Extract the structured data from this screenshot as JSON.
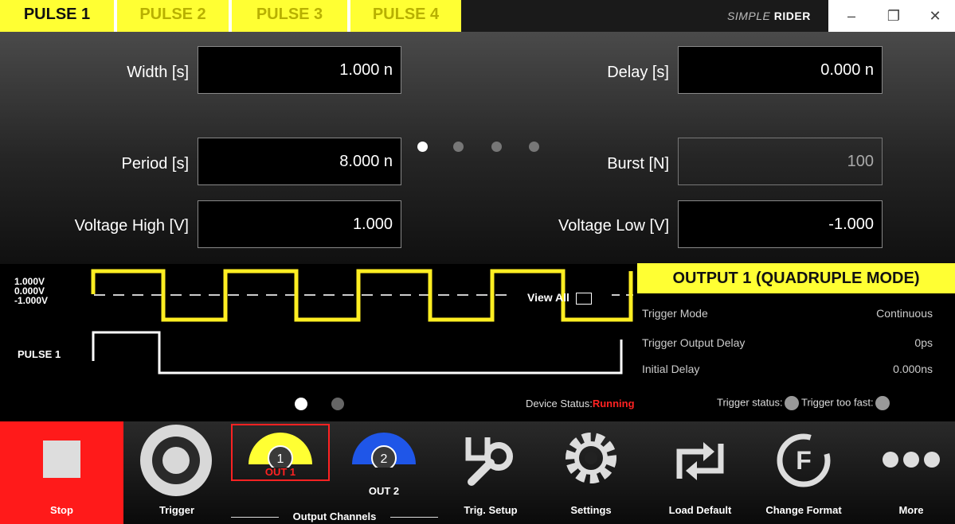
{
  "tabs": [
    "PULSE 1",
    "PULSE 2",
    "PULSE 3",
    "PULSE 4"
  ],
  "brand": {
    "prefix": "SIMPLE",
    "name": "RIDER"
  },
  "window_controls": {
    "minimize": "–",
    "restore": "❐",
    "close": "✕"
  },
  "params": {
    "width": {
      "label": "Width [s]",
      "value": "1.000 n"
    },
    "delay": {
      "label": "Delay [s]",
      "value": "0.000 n"
    },
    "period": {
      "label": "Period [s]",
      "value": "8.000 n"
    },
    "burst": {
      "label": "Burst [N]",
      "value": "100"
    },
    "vhigh": {
      "label": "Voltage High [V]",
      "value": "1.000"
    },
    "vlow": {
      "label": "Voltage Low [V]",
      "value": "-1.000"
    },
    "page_indicator": {
      "current": 1,
      "total": 4
    }
  },
  "waveform": {
    "levels": [
      "1.000V",
      "0.000V",
      "-1.000V"
    ],
    "pulse_label": "PULSE 1",
    "view_all": "View All",
    "page_indicator": {
      "current": 1,
      "total": 2
    }
  },
  "output_info": {
    "title": "OUTPUT 1 (QUADRUPLE MODE)",
    "rows": [
      {
        "label": "Trigger Mode",
        "value": "Continuous"
      },
      {
        "label": "Trigger Output Delay",
        "value": "0ps"
      },
      {
        "label": "Initial Delay",
        "value": "0.000ns"
      }
    ]
  },
  "status": {
    "device_label": "Device Status:",
    "device_value": "Running",
    "trigger_status": "Trigger status:",
    "trigger_too_fast": "Trigger too fast:"
  },
  "toolbar": {
    "stop": "Stop",
    "trigger": "Trigger",
    "out1": "OUT 1",
    "out1_num": "1",
    "out2": "OUT 2",
    "out2_num": "2",
    "output_channels": "Output Channels",
    "trig_setup": "Trig. Setup",
    "settings": "Settings",
    "load_default": "Load Default",
    "change_format": "Change Format",
    "more": "More"
  },
  "colors": {
    "accent": "#ffff33",
    "stop": "#ff1a1a",
    "out2": "#1f56e8",
    "running": "#ff2222"
  }
}
